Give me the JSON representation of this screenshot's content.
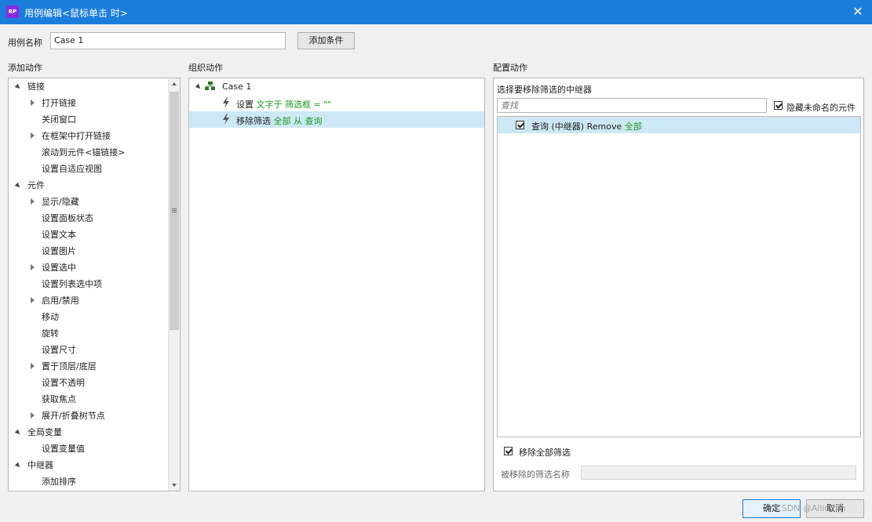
{
  "window": {
    "app_icon": "RP",
    "title": "用例编辑<鼠标单击 时>"
  },
  "case_name": {
    "label": "用例名称",
    "value": "Case 1",
    "add_condition": "添加条件"
  },
  "sections": {
    "add_action": "添加动作",
    "organize_action": "组织动作",
    "configure_action": "配置动作"
  },
  "add_actions": [
    {
      "label": "链接",
      "level": 0,
      "expand": "open"
    },
    {
      "label": "打开链接",
      "level": 1,
      "expand": "closed"
    },
    {
      "label": "关闭窗口",
      "level": 1,
      "expand": "none"
    },
    {
      "label": "在框架中打开链接",
      "level": 1,
      "expand": "closed"
    },
    {
      "label": "滚动到元件<锚链接>",
      "level": 1,
      "expand": "none"
    },
    {
      "label": "设置自适应视图",
      "level": 1,
      "expand": "none"
    },
    {
      "label": "元件",
      "level": 0,
      "expand": "open"
    },
    {
      "label": "显示/隐藏",
      "level": 1,
      "expand": "closed"
    },
    {
      "label": "设置面板状态",
      "level": 1,
      "expand": "none"
    },
    {
      "label": "设置文本",
      "level": 1,
      "expand": "none"
    },
    {
      "label": "设置图片",
      "level": 1,
      "expand": "none"
    },
    {
      "label": "设置选中",
      "level": 1,
      "expand": "closed"
    },
    {
      "label": "设置列表选中项",
      "level": 1,
      "expand": "none"
    },
    {
      "label": "启用/禁用",
      "level": 1,
      "expand": "closed"
    },
    {
      "label": "移动",
      "level": 1,
      "expand": "none"
    },
    {
      "label": "旋转",
      "level": 1,
      "expand": "none"
    },
    {
      "label": "设置尺寸",
      "level": 1,
      "expand": "none"
    },
    {
      "label": "置于顶层/底层",
      "level": 1,
      "expand": "closed"
    },
    {
      "label": "设置不透明",
      "level": 1,
      "expand": "none"
    },
    {
      "label": "获取焦点",
      "level": 1,
      "expand": "none"
    },
    {
      "label": "展开/折叠树节点",
      "level": 1,
      "expand": "closed"
    },
    {
      "label": "全局变量",
      "level": 0,
      "expand": "open"
    },
    {
      "label": "设置变量值",
      "level": 1,
      "expand": "none"
    },
    {
      "label": "中继器",
      "level": 0,
      "expand": "open"
    },
    {
      "label": "添加排序",
      "level": 1,
      "expand": "none"
    }
  ],
  "organize": {
    "case_label": "Case 1",
    "action1": {
      "prefix": "设置",
      "detail": "文字于 筛选框 = \"\""
    },
    "action2": {
      "prefix": "移除筛选",
      "detail": "全部 从 查询"
    }
  },
  "configure": {
    "heading": "选择要移除筛选的中继器",
    "search_placeholder": "查找",
    "hide_unnamed": {
      "label": "隐藏未命名的元件",
      "checked": true
    },
    "repeater_item": {
      "name": "查询 (中继器) Remove",
      "detail": "全部",
      "checked": true
    },
    "remove_all": {
      "label": "移除全部筛选",
      "checked": true
    },
    "filter_name_label": "被移除的筛选名称",
    "filter_name_value": ""
  },
  "footer": {
    "ok": "确定",
    "cancel": "取消",
    "watermark": "CSDN @Allin2lin"
  }
}
